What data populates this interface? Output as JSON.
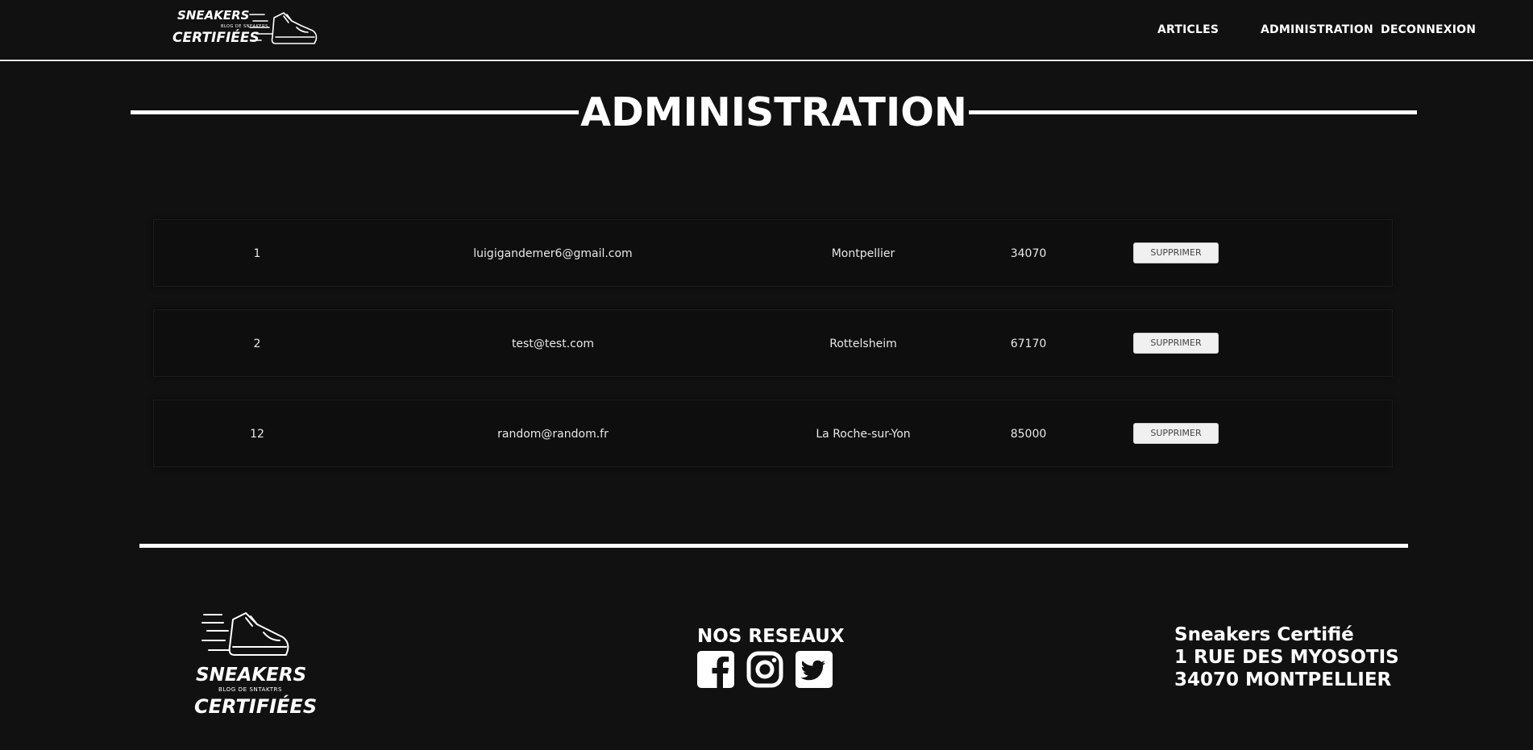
{
  "brand": {
    "logo_line1": "SNEAKERS",
    "logo_tagline": "BLOG DE SNEAKERS",
    "logo_line2": "CERTIFIÉES"
  },
  "nav": {
    "items": [
      "ARTICLES",
      "ADMINISTRATION",
      "DECONNEXION"
    ]
  },
  "page": {
    "title": "ADMINISTRATION"
  },
  "users": [
    {
      "id": "1",
      "email": "luigigandemer6@gmail.com",
      "city": "Montpellier",
      "zip": "34070",
      "action": "SUPPRIMER"
    },
    {
      "id": "2",
      "email": "test@test.com",
      "city": "Rottelsheim",
      "zip": "67170",
      "action": "SUPPRIMER"
    },
    {
      "id": "12",
      "email": "random@random.fr",
      "city": "La Roche-sur-Yon",
      "zip": "85000",
      "action": "SUPPRIMER"
    }
  ],
  "footer": {
    "logo_line1": "SNEAKERS",
    "logo_tagline": "BLOG DE SNTAKTRS",
    "logo_line2": "CERTIFIÉES",
    "social_title": "NOS RESEAUX",
    "social_icons": [
      "facebook-icon",
      "instagram-icon",
      "twitter-icon"
    ],
    "address_line1": "Sneakers Certifié",
    "address_line2": "1 RUE DES MYOSOTIS",
    "address_line3": "34070 MONTPELLIER"
  },
  "colors": {
    "background": "#111111",
    "text": "#ffffff",
    "button_bg": "#f0f0f0"
  }
}
